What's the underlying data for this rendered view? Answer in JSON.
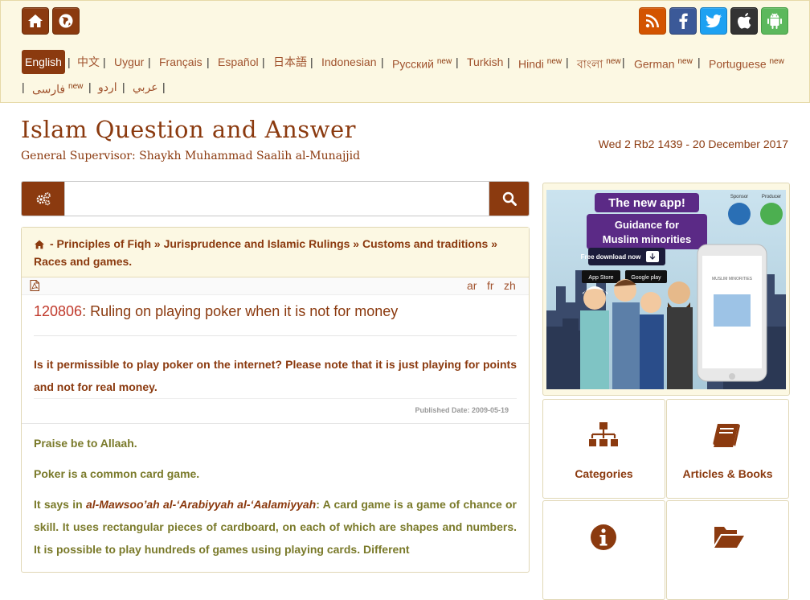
{
  "top_icons": {
    "home": "home-icon",
    "globe": "globe-icon",
    "rss": "rss-icon",
    "facebook": "facebook-icon",
    "twitter": "twitter-icon",
    "apple": "apple-icon",
    "android": "android-icon"
  },
  "languages_row1": [
    {
      "label": "English",
      "new": "",
      "active": true
    },
    {
      "label": "中文",
      "new": ""
    },
    {
      "label": "Uygur",
      "new": ""
    },
    {
      "label": "Français",
      "new": ""
    },
    {
      "label": "Español",
      "new": ""
    },
    {
      "label": "日本語",
      "new": ""
    },
    {
      "label": "Indonesian",
      "new": ""
    },
    {
      "label": "Русский",
      "new": "new"
    },
    {
      "label": "Turkish",
      "new": ""
    },
    {
      "label": "Hindi",
      "new": "new"
    },
    {
      "label": "বাংলা",
      "new": "new"
    },
    {
      "label": "German",
      "new": "new"
    },
    {
      "label": "Portuguese",
      "new": "new"
    }
  ],
  "languages_row2": [
    {
      "label": "فارسی",
      "new": "new"
    },
    {
      "label": "اردو",
      "new": ""
    },
    {
      "label": "عربي",
      "new": ""
    }
  ],
  "separator": "|",
  "header": {
    "title": "Islam Question and Answer",
    "subtitle": "General Supervisor: Shaykh Muhammad Saalih al-Munajjid",
    "date": "Wed 2 Rb2 1439 - 20 December 2017"
  },
  "search": {
    "placeholder": "",
    "value": ""
  },
  "breadcrumb": {
    "text": "- Principles of Fiqh » Jurisprudence and Islamic Rulings » Customs and traditions » Races and games."
  },
  "translations": [
    "ar",
    "fr",
    "zh"
  ],
  "question": {
    "number": "120806",
    "title": ": Ruling on playing poker when it is not for money",
    "body": "Is it permissible to play poker on the internet? Please note that it is just playing for points and not for real money.",
    "published": "Published Date: 2009-05-19"
  },
  "answer": {
    "p1": "Praise be to Allaah.",
    "p2": "Poker is a common card game.",
    "p3_lead": "It says in ",
    "p3_source": "al-Mawsoo’ah al-‘Arabiyyah al-‘Aalamiyyah",
    "p3_rest": ": A card game is a game of chance or skill. It uses rectangular pieces of cardboard, on each of which are shapes and numbers. It is possible to play hundreds of games using playing cards. Different"
  },
  "ad": {
    "headline": "The new app!",
    "subline1": "Guidance for",
    "subline2": "Muslim minorities",
    "cta": "Free download now",
    "store1": "App Store",
    "store2": "Google play",
    "sponsor": "Sponsor",
    "producer": "Producer",
    "phone_title": "MUSLIM MINORITIES"
  },
  "tiles": [
    {
      "label": "Categories",
      "icon": "sitemap-icon"
    },
    {
      "label": "Articles & Books",
      "icon": "book-icon"
    },
    {
      "label": "",
      "icon": "info-icon"
    },
    {
      "label": "",
      "icon": "folder-open-icon"
    }
  ],
  "colors": {
    "brand": "#8b3a0f",
    "bar_bg": "#fcf8e3",
    "qnum": "#c0392b"
  }
}
